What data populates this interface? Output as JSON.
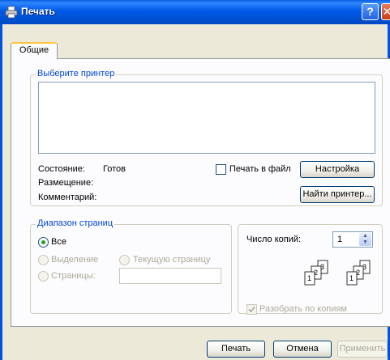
{
  "window": {
    "title": "Печать"
  },
  "tabs": [
    {
      "label": "Общие"
    }
  ],
  "printer_group": {
    "legend": "Выберите принтер",
    "status_label": "Состояние:",
    "status_value": "Готов",
    "location_label": "Размещение:",
    "comment_label": "Комментарий:",
    "print_to_file_label": "Печать в файл",
    "settings_button": "Настройка",
    "find_printer_button": "Найти принтер..."
  },
  "range_group": {
    "legend": "Диапазон страниц",
    "all_label": "Все",
    "selection_label": "Выделение",
    "current_page_label": "Текущую страницу",
    "pages_label": "Страницы:",
    "pages_value": ""
  },
  "copies_group": {
    "copies_label": "Число копий:",
    "copies_value": "1",
    "collate_label": "Разобрать по копиям",
    "collate_checked": true
  },
  "footer": {
    "print_button": "Печать",
    "cancel_button": "Отмена",
    "apply_button": "Применить"
  },
  "colors": {
    "title_bar": "#0054e3",
    "legend_text": "#0046d5",
    "accent_tab": "#ffc83c"
  }
}
